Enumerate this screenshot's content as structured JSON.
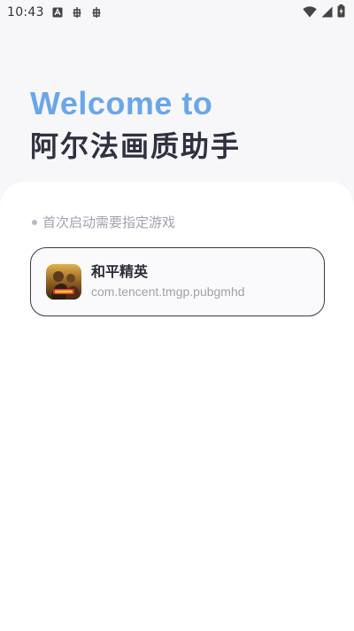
{
  "status_bar": {
    "time": "10:43",
    "icons": [
      "font-a-icon",
      "bug-icon",
      "bug-icon",
      "wifi-icon",
      "signal-icon",
      "battery-charging-icon"
    ]
  },
  "header": {
    "welcome": "Welcome to",
    "title": "阿尔法画质助手"
  },
  "content": {
    "hint": "首次启动需要指定游戏",
    "game": {
      "name": "和平精英",
      "package": "com.tencent.tmgp.pubgmhd",
      "icon": "game-app-icon"
    }
  },
  "colors": {
    "accent": "#6aa6ea",
    "title": "#2f3140",
    "background": "#f7f7f9",
    "sheet": "#ffffff",
    "muted": "#a1a3ad",
    "card_border": "#3a3b45"
  }
}
